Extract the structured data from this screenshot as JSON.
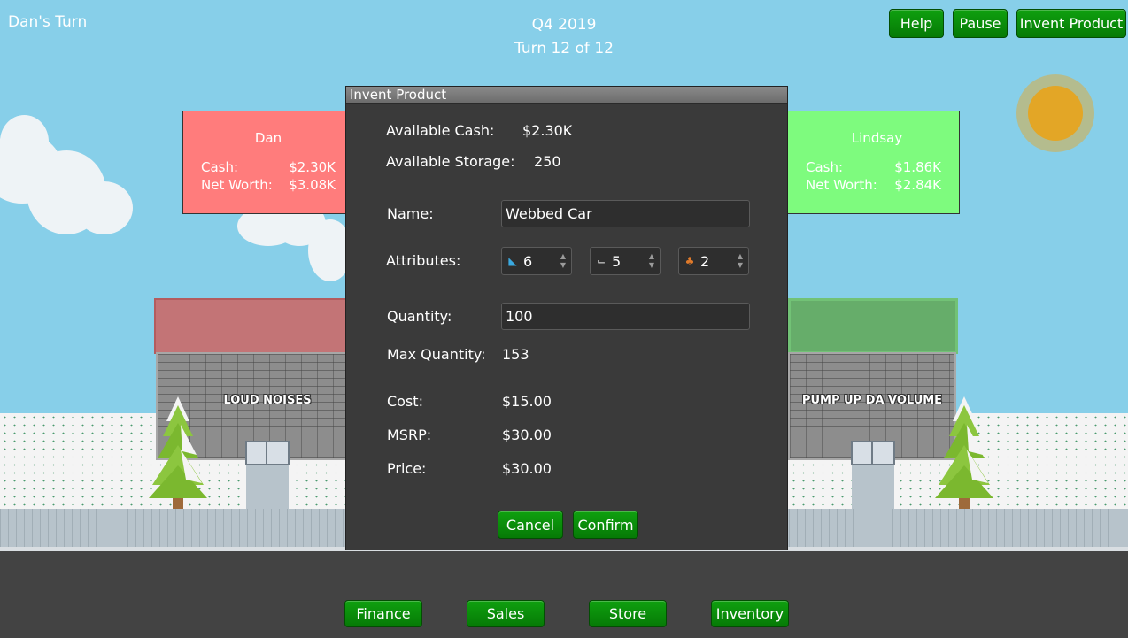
{
  "header": {
    "turn_owner": "Dan's Turn",
    "quarter": "Q4 2019",
    "turn": "Turn 12 of 12",
    "help_label": "Help",
    "pause_label": "Pause",
    "invent_label": "Invent Product"
  },
  "players": [
    {
      "name": "Dan",
      "cash_label": "Cash:",
      "cash": "$2.30K",
      "networth_label": "Net Worth:",
      "networth": "$3.08K",
      "color": "#ff7c7c"
    },
    {
      "name": "Lindsay",
      "cash_label": "Cash:",
      "cash": "$1.86K",
      "networth_label": "Net Worth:",
      "networth": "$2.84K",
      "color": "#7efb7e"
    }
  ],
  "stores": [
    {
      "name": "LOUD NOISES"
    },
    {
      "name": "PUMP UP DA VOLUME"
    }
  ],
  "dialog": {
    "title": "Invent Product",
    "available_cash_label": "Available Cash:",
    "available_cash": "$2.30K",
    "available_storage_label": "Available Storage:",
    "available_storage": "250",
    "name_label": "Name:",
    "name_value": "Webbed Car",
    "attributes_label": "Attributes:",
    "attributes": [
      {
        "icon": "boot-icon",
        "value": "6",
        "color": "#3aa9e0"
      },
      {
        "icon": "shoe-icon",
        "value": "5",
        "color": "#e8e8e8"
      },
      {
        "icon": "cluster-icon",
        "value": "2",
        "color": "#e07a2a"
      }
    ],
    "quantity_label": "Quantity:",
    "quantity_value": "100",
    "max_quantity_label": "Max Quantity:",
    "max_quantity": "153",
    "cost_label": "Cost:",
    "cost": "$15.00",
    "msrp_label": "MSRP:",
    "msrp": "$30.00",
    "price_label": "Price:",
    "price": "$30.00",
    "cancel_label": "Cancel",
    "confirm_label": "Confirm"
  },
  "bottom_nav": {
    "finance_label": "Finance",
    "sales_label": "Sales",
    "store_label": "Store",
    "inventory_label": "Inventory"
  },
  "colors": {
    "sky": "#87cfe9",
    "button_green": "#0b8f0b",
    "sun": "#e3a626"
  }
}
